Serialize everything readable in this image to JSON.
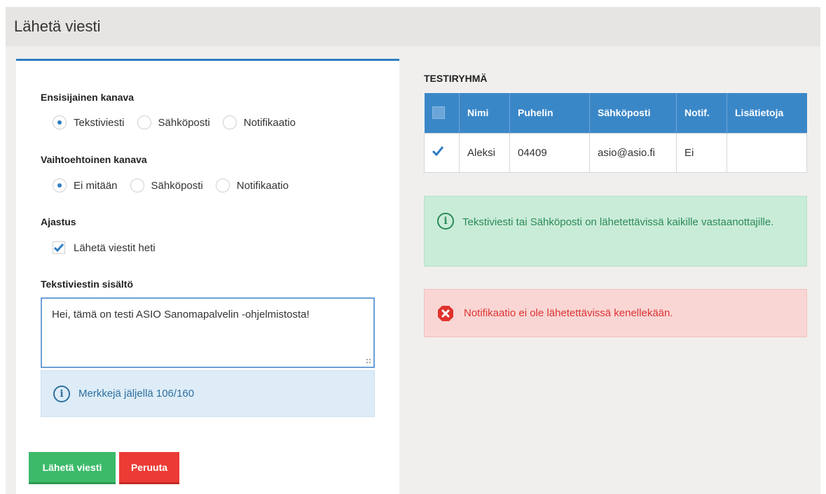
{
  "header": {
    "title": "Lähetä viesti"
  },
  "form": {
    "primary_channel": {
      "label": "Ensisijainen kanava",
      "options": [
        "Tekstiviesti",
        "Sähköposti",
        "Notifikaatio"
      ],
      "selected": "Tekstiviesti"
    },
    "alternate_channel": {
      "label": "Vaihtoehtoinen kanava",
      "options": [
        "Ei mitään",
        "Sähköposti",
        "Notifikaatio"
      ],
      "selected": "Ei mitään"
    },
    "schedule": {
      "label": "Ajastus",
      "send_now_label": "Lähetä viestit heti",
      "send_now_checked": true
    },
    "message": {
      "label": "Tekstiviestin sisältö",
      "value": "Hei, tämä on testi ASIO Sanomapalvelin -ohjelmistosta!",
      "chars_left_text": "Merkkejä jäljellä 106/160"
    },
    "buttons": {
      "send": "Lähetä viesti",
      "cancel": "Peruuta"
    }
  },
  "group": {
    "title": "TESTIRYHMÄ",
    "columns": [
      "Nimi",
      "Puhelin",
      "Sähköposti",
      "Notif.",
      "Lisätietoja"
    ],
    "rows": [
      {
        "checked": true,
        "name": "Aleksi",
        "phone": "04409",
        "email": "asio@asio.fi",
        "notif": "Ei",
        "info": ""
      }
    ]
  },
  "alerts": {
    "success": "Tekstiviesti tai Sähköposti on lähetettävissä kaikille vastaanottajille.",
    "danger": "Notifikaatio ei ole lähetettävissä kenellekään."
  },
  "colors": {
    "primary": "#3a87c8",
    "success_btn": "#3cba6a",
    "danger_btn": "#ec3b35",
    "check_blue": "#2f7dc2"
  },
  "icons": {
    "info": "info-icon",
    "error": "error-x-icon",
    "check": "checkmark-icon"
  }
}
